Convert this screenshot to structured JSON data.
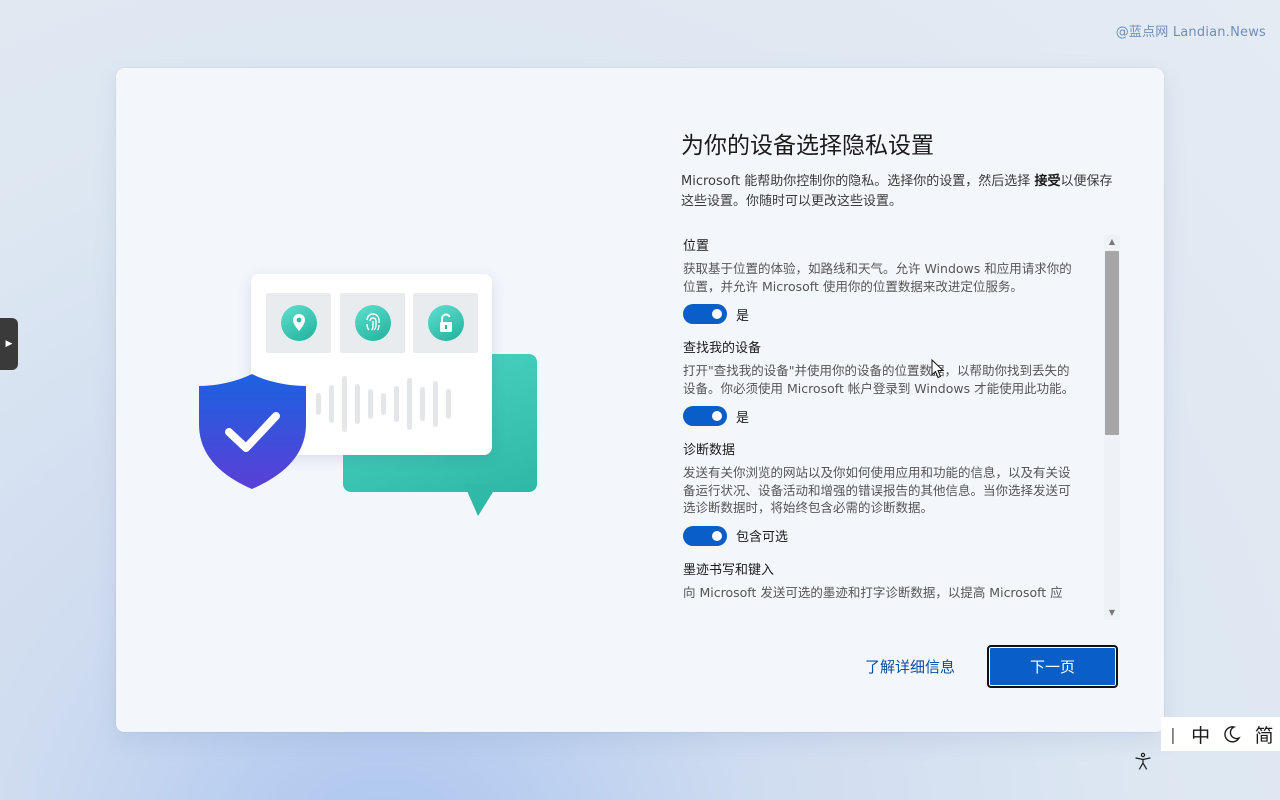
{
  "watermark": "@蓝点网 Landian.News",
  "title": "为你的设备选择隐私设置",
  "description": {
    "before": "Microsoft 能帮助你控制你的隐私。选择你的设置，然后选择 ",
    "bold": "接受",
    "after": "以便保存这些设置。你随时可以更改这些设置。"
  },
  "settings": [
    {
      "title": "位置",
      "desc": "获取基于位置的体验，如路线和天气。允许 Windows 和应用请求你的位置，并允许 Microsoft 使用你的位置数据来改进定位服务。",
      "toggle_label": "是",
      "on": true
    },
    {
      "title": "查找我的设备",
      "desc": "打开\"查找我的设备\"并使用你的设备的位置数据，以帮助你找到丢失的设备。你必须使用 Microsoft 帐户登录到 Windows 才能使用此功能。",
      "toggle_label": "是",
      "on": true
    },
    {
      "title": "诊断数据",
      "desc": "发送有关你浏览的网站以及你如何使用应用和功能的信息，以及有关设备运行状况、设备活动和增强的错误报告的其他信息。当你选择发送可选诊断数据时，将始终包含必需的诊断数据。",
      "toggle_label": "包含可选",
      "on": true
    },
    {
      "title": "墨迹书写和键入",
      "desc": "向 Microsoft 发送可选的墨迹和打字诊断数据，以提高 Microsoft 应"
    }
  ],
  "learn_more": "了解详细信息",
  "next_button": "下一页",
  "ime": {
    "mode": "中",
    "theme_icon": "moon-icon",
    "charset": "简"
  },
  "colors": {
    "accent": "#0a5ec7",
    "link": "#0a4ea5",
    "teal": "#2db8a6"
  }
}
